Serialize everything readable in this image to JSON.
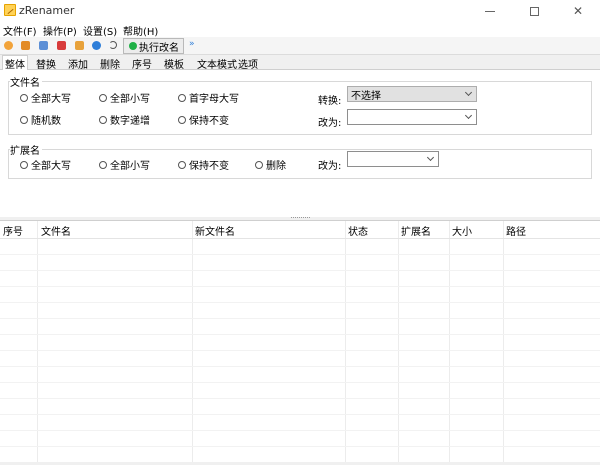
{
  "window": {
    "title": "zRenamer"
  },
  "menu": [
    "文件(F)",
    "操作(P)",
    "设置(S)",
    "帮助(H)"
  ],
  "toolbar": {
    "icons": [
      {
        "name": "new-icon",
        "color": "#f2a33a"
      },
      {
        "name": "folder-icon",
        "color": "#e38b26"
      },
      {
        "name": "copy-icon",
        "color": "#5c8fd6"
      },
      {
        "name": "delete-icon",
        "color": "#d83b3b"
      },
      {
        "name": "image-icon",
        "color": "#e8a23b"
      },
      {
        "name": "globe-icon",
        "color": "#2f7fd9"
      },
      {
        "name": "undo-icon",
        "color": "#555555"
      }
    ],
    "execute_label": "执行改名",
    "execute_color": "#1fb046",
    "extra_icon": "arrow-icon"
  },
  "tabs": [
    "整体",
    "替换",
    "添加",
    "删除",
    "序号",
    "模板",
    "文本模式",
    "选项"
  ],
  "filename_group": {
    "title": "文件名",
    "options": [
      "全部大写",
      "全部小写",
      "首字母大写",
      "随机数",
      "数字递增",
      "保持不变"
    ],
    "convert_label": "转换:",
    "convert_value": "不选择",
    "change_label": "改为:",
    "change_value": ""
  },
  "extension_group": {
    "title": "扩展名",
    "options": [
      "全部大写",
      "全部小写",
      "保持不变",
      "删除"
    ],
    "change_label": "改为:",
    "change_value": ""
  },
  "table": {
    "columns": [
      "序号",
      "文件名",
      "新文件名",
      "状态",
      "扩展名",
      "大小",
      "路径"
    ]
  }
}
